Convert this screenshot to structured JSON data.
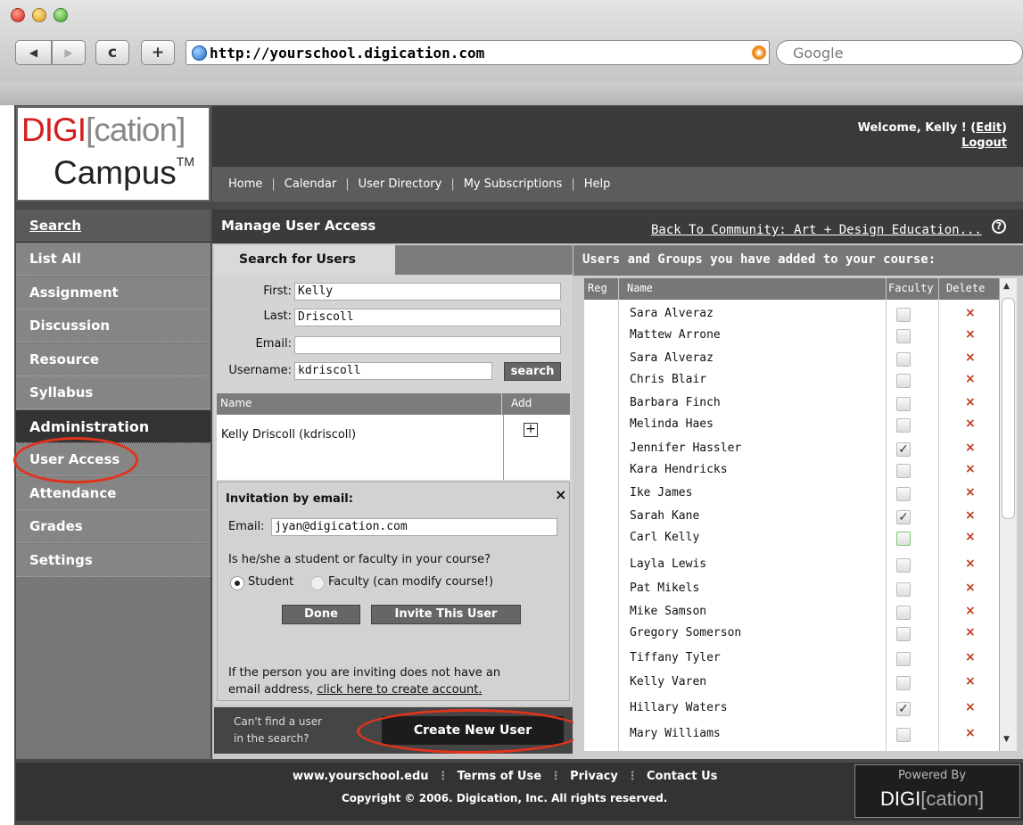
{
  "browser": {
    "url": "http://yourschool.digication.com",
    "search_placeholder": "Google",
    "back_icon": "◀",
    "forward_icon": "▶",
    "reload_icon": "c",
    "add_icon": "+"
  },
  "logo": {
    "digi": "DIGI",
    "cation": "[cation]",
    "campus": "Campus",
    "tm": "TM"
  },
  "header": {
    "welcome": "Welcome, Kelly ! (",
    "edit": "Edit",
    "welcome_end": ")",
    "logout": "Logout"
  },
  "nav": {
    "items": [
      "Home",
      "Calendar",
      "User Directory",
      "My Subscriptions",
      "Help"
    ]
  },
  "sidebar": {
    "items": [
      "Search",
      "List All",
      "Assignment",
      "Discussion",
      "Resource",
      "Syllabus",
      "Administration",
      "User Access",
      "Attendance",
      "Grades",
      "Settings"
    ]
  },
  "page": {
    "title": "Manage User Access",
    "back_link": "Back To Community: Art + Design Education...",
    "help": "?"
  },
  "search": {
    "tab": "Search for Users",
    "first_label": "First:",
    "first_value": "Kelly",
    "last_label": "Last:",
    "last_value": "Driscoll",
    "email_label": "Email:",
    "email_value": "",
    "username_label": "Username:",
    "username_value": "kdriscoll",
    "search_button": "search",
    "col_name": "Name",
    "col_add": "Add",
    "result": "Kelly Driscoll (kdriscoll)",
    "plus": "+"
  },
  "invite": {
    "title": "Invitation by email:",
    "close": "×",
    "email_label": "Email:",
    "email_value": "jyan@digication.com",
    "question": "Is he/she a student or faculty in your course?",
    "student": "Student",
    "faculty": "Faculty (can modify course!)",
    "done": "Done",
    "invite_button": "Invite This User",
    "note_1": "If the person you are inviting does not have an",
    "note_2": "email address,",
    "note_link": "click here to create account."
  },
  "create": {
    "line1": "Can't find a user",
    "line2": "in the search?",
    "button": "Create New User"
  },
  "users_panel": {
    "title": "Users and Groups you have added to your course:",
    "col_reg": "Reg",
    "col_name": "Name",
    "col_faculty": "Faculty",
    "col_delete": "Delete",
    "delete_glyph": "×",
    "check_glyph": "✓",
    "rows": [
      {
        "name": "Sara Alveraz",
        "faculty": false
      },
      {
        "name": "Mattew Arrone",
        "faculty": false
      },
      {
        "name": "Sara Alveraz",
        "faculty": false
      },
      {
        "name": "Chris Blair",
        "faculty": false
      },
      {
        "name": "Barbara Finch",
        "faculty": false
      },
      {
        "name": "Melinda Haes",
        "faculty": false
      },
      {
        "name": "Jennifer Hassler",
        "faculty": true
      },
      {
        "name": "Kara Hendricks",
        "faculty": false
      },
      {
        "name": "Ike James",
        "faculty": false
      },
      {
        "name": "Sarah Kane",
        "faculty": true
      },
      {
        "name": "Carl Kelly",
        "faculty": false
      },
      {
        "name": "Layla Lewis",
        "faculty": false
      },
      {
        "name": "Pat Mikels",
        "faculty": false
      },
      {
        "name": "Mike Samson",
        "faculty": false
      },
      {
        "name": "Gregory Somerson",
        "faculty": false
      },
      {
        "name": "Tiffany Tyler",
        "faculty": false
      },
      {
        "name": "Kelly Varen",
        "faculty": false
      },
      {
        "name": "Hillary Waters",
        "faculty": true
      },
      {
        "name": "Mary Williams",
        "faculty": false
      }
    ]
  },
  "footer": {
    "links": [
      "www.yourschool.edu",
      "Terms of Use",
      "Privacy",
      "Contact Us"
    ],
    "copyright": "Copyright © 2006. Digication, Inc. All rights reserved.",
    "powered_by": "Powered By",
    "powered_logo_digi": "DIGI",
    "powered_logo_cation": "[cation]"
  },
  "colors": {
    "accent_red": "#d41d1d",
    "highlight_circle": "#e0331c",
    "delete_x": "#c0391b"
  }
}
